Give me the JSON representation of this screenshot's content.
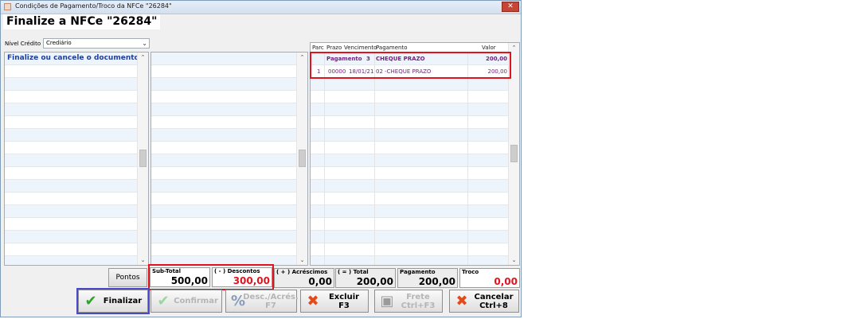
{
  "window": {
    "title": "Condições de Pagamento/Troco da NFCe \"26284\"",
    "close_glyph": "✕"
  },
  "header": {
    "title": "Finalize a NFCe \"26284\""
  },
  "nivel_credito": {
    "label": "Nível Crédito",
    "value": "Crediário",
    "arrow": "⌄"
  },
  "left_panel": {
    "message": "Finalize ou cancele o documento",
    "scroll_up": "⌃",
    "scroll_down": "⌄"
  },
  "middle_panel": {
    "scroll_up": "⌃",
    "scroll_down": "⌄"
  },
  "payment_grid": {
    "columns": [
      "Parc",
      "Prazo",
      "Vencimento",
      "Pagamento",
      "Valor"
    ],
    "summary": {
      "label": "Pagamento",
      "count": "3",
      "type": "CHEQUE PRAZO",
      "value": "200,00"
    },
    "rows": [
      {
        "parc": "1",
        "prazo": "00000",
        "vencimento": "18/01/21",
        "pagamento": "02 -CHEQUE PRAZO",
        "valor": "200,00"
      }
    ],
    "scroll_up": "⌃",
    "scroll_down": "⌄"
  },
  "totals": {
    "pontos_label": "Pontos",
    "subtotal": {
      "label": "Sub-Total",
      "value": "500,00"
    },
    "descontos": {
      "label": "( - ) Descontos",
      "value": "300,00"
    },
    "acrescimos": {
      "label": "( + ) Acréscimos",
      "value": "0,00"
    },
    "total": {
      "label": "( = ) Total",
      "value": "200,00"
    },
    "pagamento": {
      "label": "Pagamento",
      "value": "200,00"
    },
    "troco": {
      "label": "Troco",
      "value": "0,00"
    }
  },
  "buttons": {
    "finalizar": {
      "label": "Finalizar",
      "icon": "check-icon",
      "glyph": "✔"
    },
    "confirmar": {
      "label": "Confirmar",
      "icon": "check-icon",
      "glyph": "✔"
    },
    "desc": {
      "line1": "Desc./Acrés.",
      "line2": "F7",
      "icon": "percent-icon",
      "glyph": "%"
    },
    "excluir": {
      "line1": "Excluir",
      "line2": "F3",
      "icon": "x-icon",
      "glyph": "✖"
    },
    "frete": {
      "line1": "Frete",
      "line2": "Ctrl+F3",
      "icon": "truck-icon",
      "glyph": "▣"
    },
    "cancelar": {
      "line1": "Cancelar",
      "line2": "Ctrl+8",
      "icon": "x-icon",
      "glyph": "✖"
    }
  },
  "colors": {
    "title_blue": "#1f3e9c",
    "purple": "#7a1c87",
    "red": "#e0141e",
    "green": "#2aa52a",
    "orange_red": "#e24a1a"
  }
}
